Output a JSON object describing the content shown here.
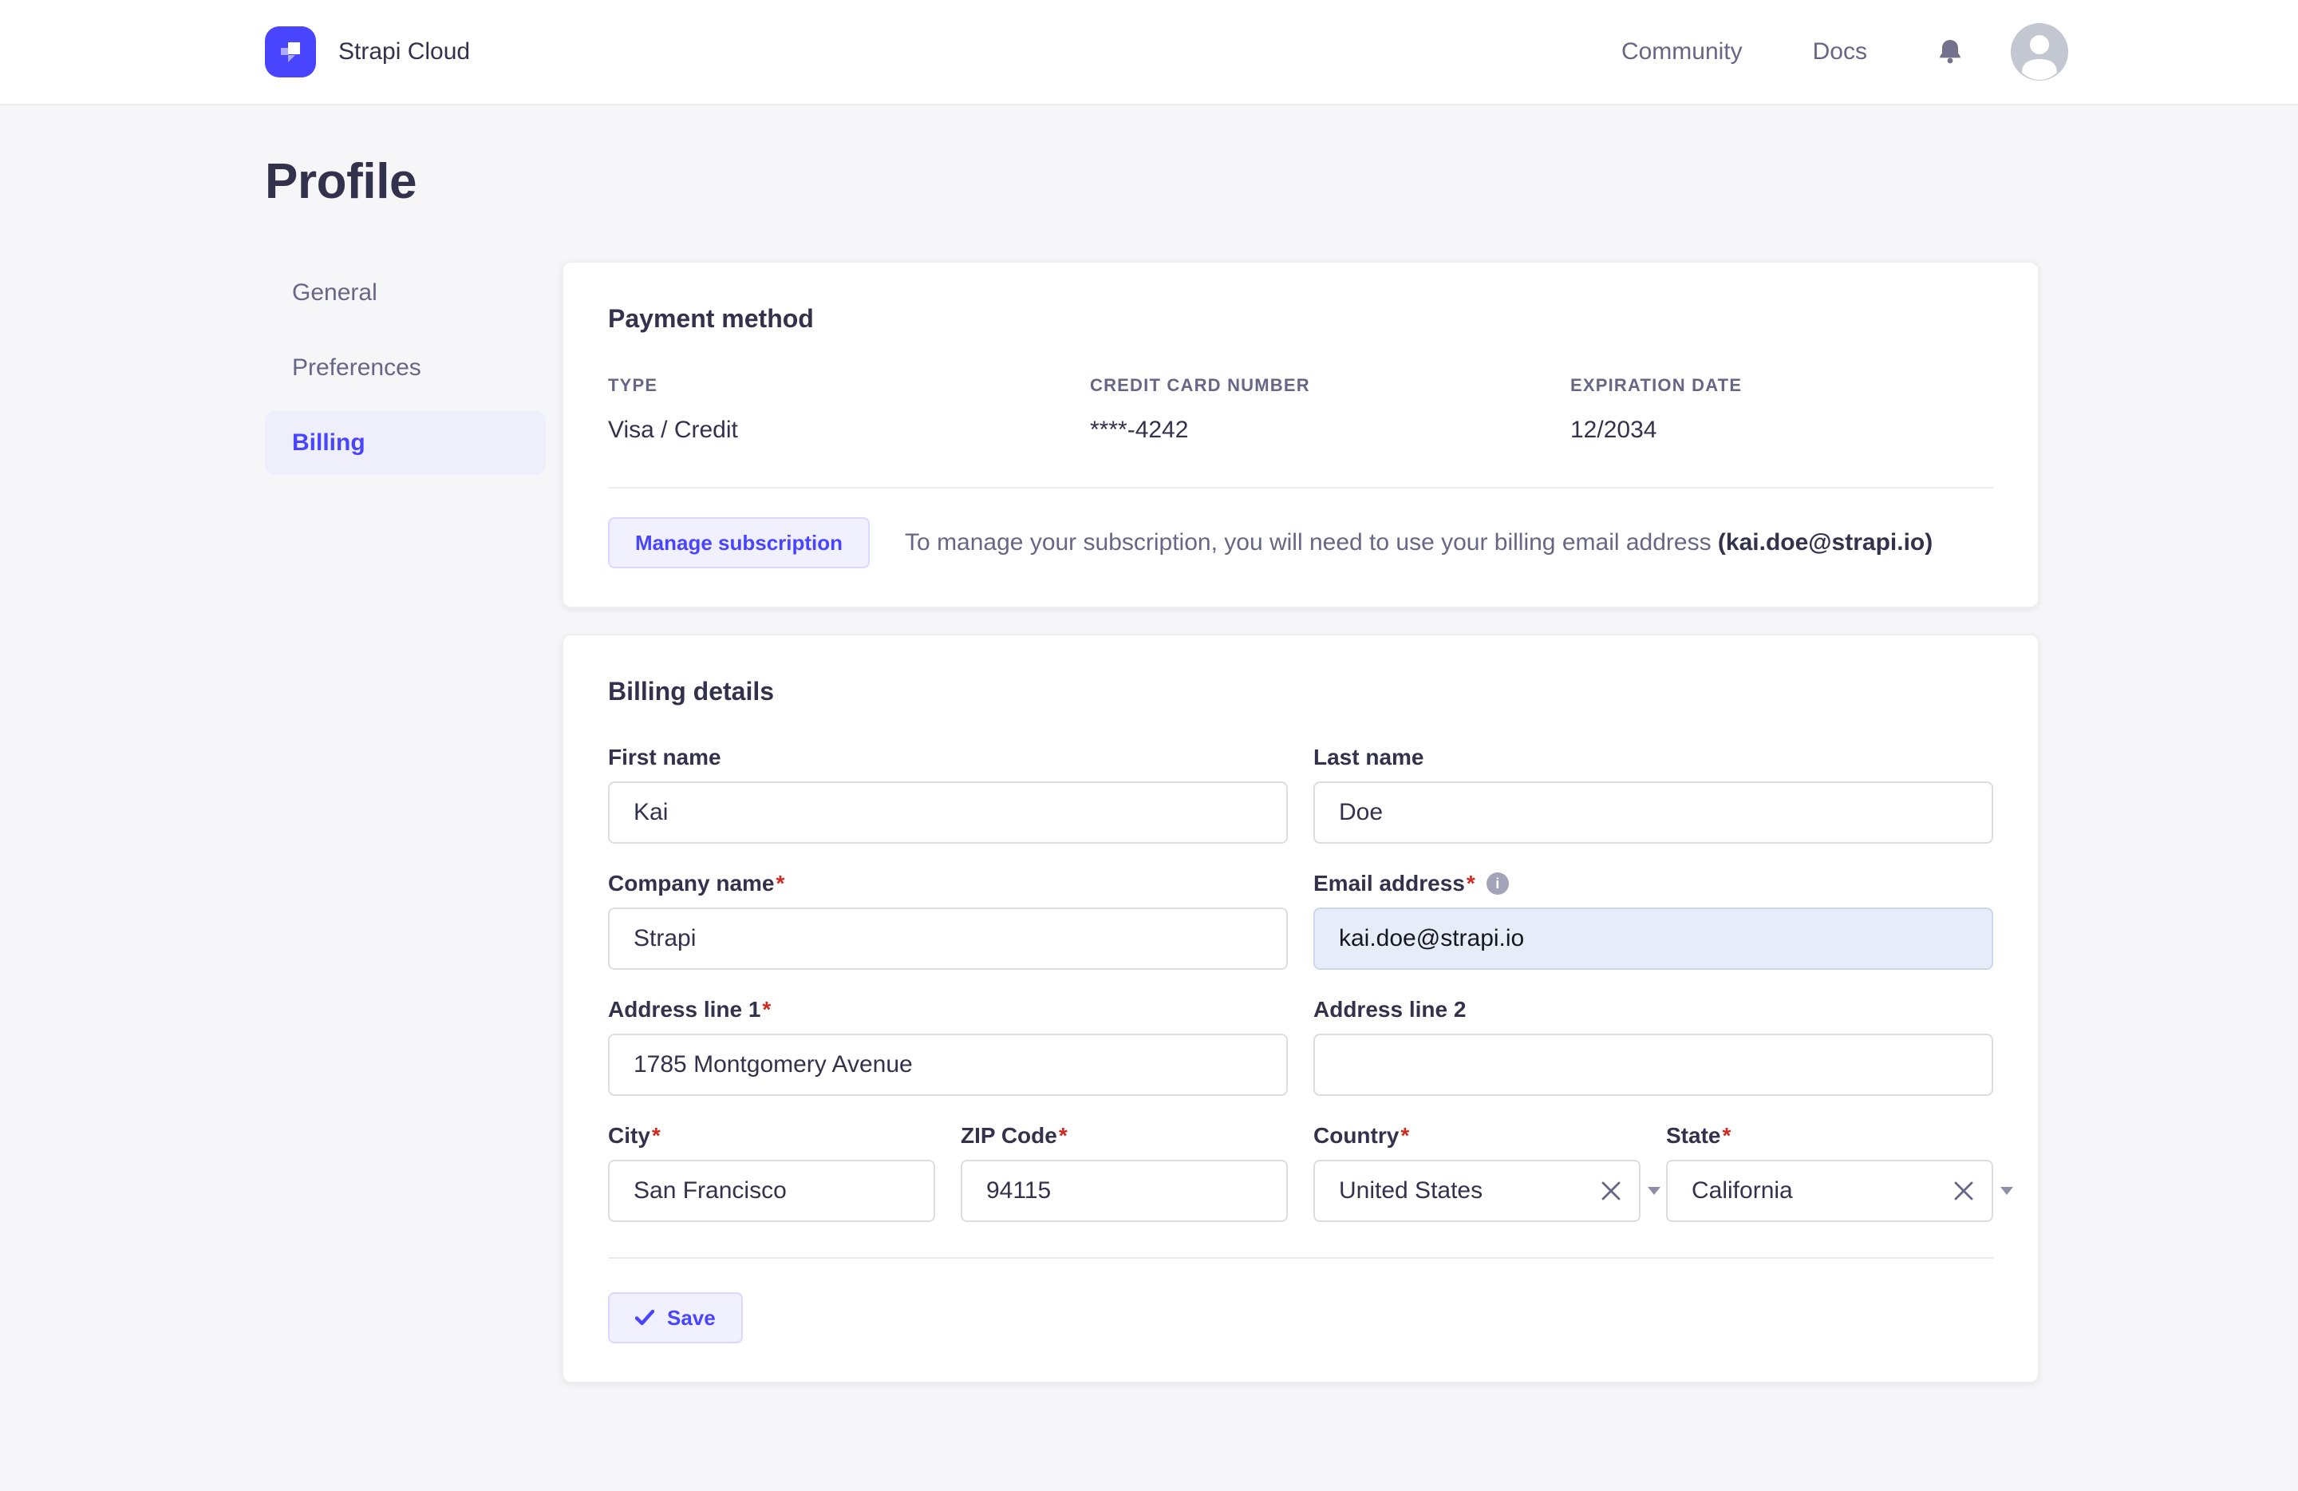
{
  "header": {
    "brand": "Strapi Cloud",
    "nav": [
      {
        "label": "Community"
      },
      {
        "label": "Docs"
      }
    ]
  },
  "page": {
    "title": "Profile"
  },
  "sidebar": {
    "items": [
      {
        "label": "General"
      },
      {
        "label": "Preferences"
      },
      {
        "label": "Billing"
      }
    ]
  },
  "payment": {
    "title": "Payment method",
    "fields": [
      {
        "label": "TYPE",
        "value": "Visa / Credit"
      },
      {
        "label": "CREDIT CARD NUMBER",
        "value": "****-4242"
      },
      {
        "label": "EXPIRATION DATE",
        "value": "12/2034"
      }
    ],
    "manage_button_label": "Manage subscription",
    "note_prefix": "To manage your subscription, you will need to use your billing email address ",
    "note_email": "(kai.doe@strapi.io)"
  },
  "billing": {
    "title": "Billing details",
    "required_marker": "*",
    "fields": {
      "first_name": {
        "label": "First name",
        "value": "Kai"
      },
      "last_name": {
        "label": "Last name",
        "value": "Doe"
      },
      "company_name": {
        "label": "Company name",
        "value": "Strapi"
      },
      "email": {
        "label": "Email address",
        "value": "kai.doe@strapi.io"
      },
      "address1": {
        "label": "Address line 1",
        "value": "1785 Montgomery Avenue"
      },
      "address2": {
        "label": "Address line 2",
        "value": ""
      },
      "city": {
        "label": "City",
        "value": "San Francisco"
      },
      "zip": {
        "label": "ZIP Code",
        "value": "94115"
      },
      "country": {
        "label": "Country",
        "value": "United States"
      },
      "state": {
        "label": "State",
        "value": "California"
      }
    },
    "save_button_label": "Save"
  },
  "colors": {
    "primary": "#4945FF",
    "primary_light": "#F0F0FF",
    "primary_border": "#D9D8FF",
    "heading": "#32324D",
    "muted": "#666687",
    "page_bg": "#F6F6F9",
    "card_border": "#EAEAEF",
    "input_border": "#DCDCE4",
    "required": "#D02B20",
    "disabled_input_bg": "#E6EDF9"
  }
}
